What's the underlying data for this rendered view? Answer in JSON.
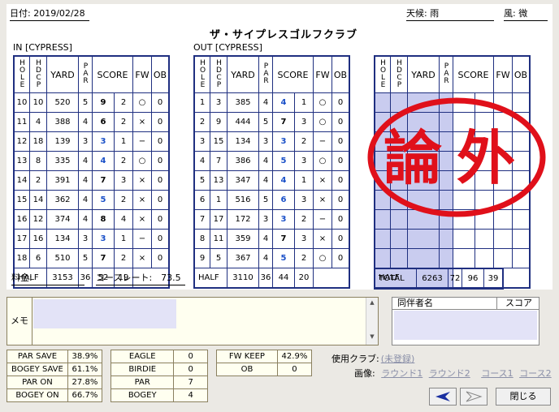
{
  "header": {
    "date_label": "日付: 2019/02/28",
    "weather": "天候: 雨",
    "wind": "風: 微",
    "club": "ザ・サイプレスゴルフクラブ"
  },
  "sections": {
    "in": "IN [CYPRESS]",
    "out": "OUT [CYPRESS]"
  },
  "columns": {
    "hole": "HOLE",
    "hdcp": "HDCP",
    "yard": "YARD",
    "par": "PAR",
    "score": "SCORE",
    "fw": "FW",
    "ob": "OB"
  },
  "in_rows": [
    [
      "10",
      "10",
      "520",
      "5",
      "9",
      "2",
      "○",
      "0"
    ],
    [
      "11",
      "4",
      "388",
      "4",
      "6",
      "2",
      "×",
      "0"
    ],
    [
      "12",
      "18",
      "139",
      "3",
      "3",
      "1",
      "−",
      "0"
    ],
    [
      "13",
      "8",
      "335",
      "4",
      "4",
      "2",
      "○",
      "0"
    ],
    [
      "14",
      "2",
      "391",
      "4",
      "7",
      "3",
      "×",
      "0"
    ],
    [
      "15",
      "14",
      "362",
      "4",
      "5",
      "2",
      "×",
      "0"
    ],
    [
      "16",
      "12",
      "374",
      "4",
      "8",
      "4",
      "×",
      "0"
    ],
    [
      "17",
      "16",
      "134",
      "3",
      "3",
      "1",
      "−",
      "0"
    ],
    [
      "18",
      "6",
      "510",
      "5",
      "7",
      "2",
      "×",
      "0"
    ]
  ],
  "out_rows": [
    [
      "1",
      "3",
      "385",
      "4",
      "4",
      "1",
      "○",
      "0"
    ],
    [
      "2",
      "9",
      "444",
      "5",
      "7",
      "3",
      "○",
      "0"
    ],
    [
      "3",
      "15",
      "134",
      "3",
      "3",
      "2",
      "−",
      "0"
    ],
    [
      "4",
      "7",
      "386",
      "4",
      "5",
      "3",
      "○",
      "0"
    ],
    [
      "5",
      "13",
      "347",
      "4",
      "4",
      "1",
      "×",
      "0"
    ],
    [
      "6",
      "1",
      "516",
      "5",
      "6",
      "3",
      "×",
      "0"
    ],
    [
      "7",
      "17",
      "172",
      "3",
      "3",
      "2",
      "−",
      "0"
    ],
    [
      "8",
      "11",
      "359",
      "4",
      "7",
      "3",
      "×",
      "0"
    ],
    [
      "9",
      "5",
      "367",
      "4",
      "5",
      "2",
      "○",
      "0"
    ]
  ],
  "in_half": {
    "label": "HALF",
    "yard": "3153",
    "par": "36",
    "score": "52",
    "putt": "19"
  },
  "out_half": {
    "label": "HALF",
    "yard": "3110",
    "par": "36",
    "score": "44",
    "putt": "20"
  },
  "third_half": {
    "label": "HALF"
  },
  "total": {
    "label": "TOTAL",
    "yard": "6263",
    "par": "72",
    "score": "96",
    "putt": "39"
  },
  "stamp": "論外",
  "fee_label": "料金:",
  "course_rate": "コースレート:　73.5",
  "memo_label": "メモ",
  "companions": {
    "name_col": "同伴者名",
    "score_col": "スコア"
  },
  "stats1": [
    [
      "PAR SAVE",
      "38.9%"
    ],
    [
      "BOGEY SAVE",
      "61.1%"
    ],
    [
      "PAR ON",
      "27.8%"
    ],
    [
      "BOGEY ON",
      "66.7%"
    ]
  ],
  "stats2": [
    [
      "EAGLE",
      "0"
    ],
    [
      "BIRDIE",
      "0"
    ],
    [
      "PAR",
      "7"
    ],
    [
      "BOGEY",
      "4"
    ]
  ],
  "stats3": [
    [
      "FW KEEP",
      "42.9%"
    ],
    [
      "OB",
      "0"
    ]
  ],
  "club_used": {
    "label": "使用クラブ:",
    "value": "(未登録)"
  },
  "images": {
    "label": "画像:",
    "links": [
      "ラウンド1",
      "ラウンド2",
      "コース1",
      "コース2"
    ]
  },
  "buttons": {
    "close": "閉じる"
  },
  "colors": {
    "grid": "#1f2f80",
    "stamp": "#e0101a",
    "fill": "#c9ccef",
    "blue": "#1a50c8"
  }
}
